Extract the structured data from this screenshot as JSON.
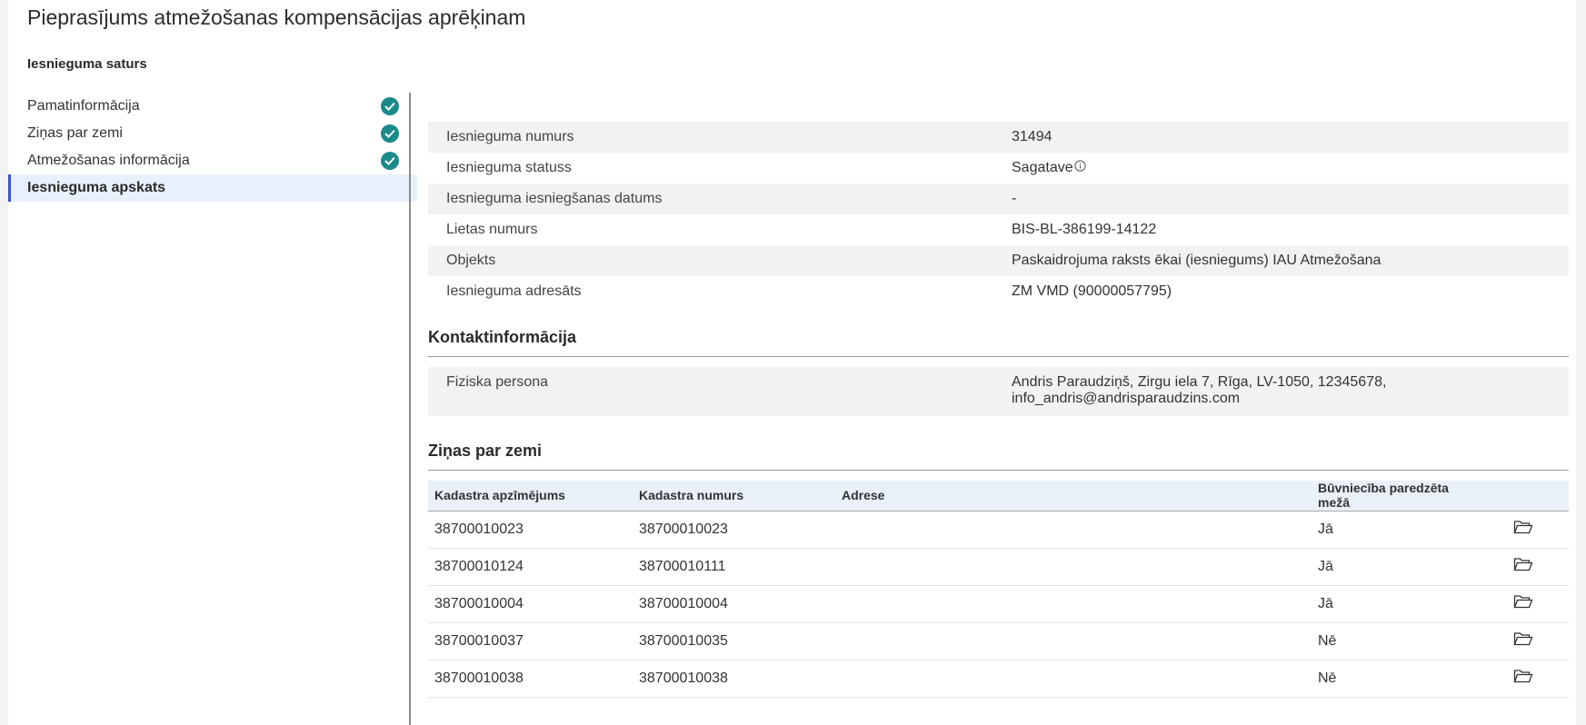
{
  "page": {
    "title": "Pieprasījums atmežošanas kompensācijas aprēķinam",
    "section_heading": "Iesnieguma saturs"
  },
  "sidebar": {
    "items": [
      {
        "label": "Pamatinformācija",
        "completed": true,
        "active": false
      },
      {
        "label": "Ziņas par zemi",
        "completed": true,
        "active": false
      },
      {
        "label": "Atmežošanas informācija",
        "completed": true,
        "active": false
      },
      {
        "label": "Iesnieguma apskats",
        "completed": false,
        "active": true
      }
    ]
  },
  "summary": {
    "rows": [
      {
        "key": "Iesnieguma numurs",
        "value": "31494"
      },
      {
        "key": "Iesnieguma statuss",
        "value": "Sagatave",
        "icon": "info-icon"
      },
      {
        "key": "Iesnieguma iesniegšanas datums",
        "value": "-"
      },
      {
        "key": "Lietas numurs",
        "value": "BIS-BL-386199-14122"
      },
      {
        "key": "Objekts",
        "value": "Paskaidrojuma raksts ēkai (iesniegums) IAU Atmežošana"
      },
      {
        "key": "Iesnieguma adresāts",
        "value": "ZM VMD (90000057795)"
      }
    ]
  },
  "contact": {
    "title": "Kontaktinformācija",
    "key": "Fiziska persona",
    "value_line1": "Andris Paraudziņš, Zirgu iela 7, Rīga, LV-1050, 12345678,",
    "value_line2": "info_andris@andrisparaudzins.com"
  },
  "land": {
    "title": "Ziņas par zemi",
    "columns": [
      "Kadastra apzīmējums",
      "Kadastra numurs",
      "Adrese",
      "Būvniecība paredzēta mežā"
    ],
    "rows": [
      {
        "apzimejums": "38700010023",
        "numurs": "38700010023",
        "adrese": "",
        "mezs": "Jā"
      },
      {
        "apzimejums": "38700010124",
        "numurs": "38700010111",
        "adrese": "",
        "mezs": "Jā"
      },
      {
        "apzimejums": "38700010004",
        "numurs": "38700010004",
        "adrese": "",
        "mezs": "Jā"
      },
      {
        "apzimejums": "38700010037",
        "numurs": "38700010035",
        "adrese": "",
        "mezs": "Nē"
      },
      {
        "apzimejums": "38700010038",
        "numurs": "38700010038",
        "adrese": "",
        "mezs": "Nē"
      }
    ],
    "row_icon": "folder-open-icon"
  },
  "colors": {
    "check": "#1b8a8a",
    "active_bar": "#3c4fd8",
    "active_bg": "#e8f1fb",
    "table_header_bg": "#eaf0f7"
  }
}
